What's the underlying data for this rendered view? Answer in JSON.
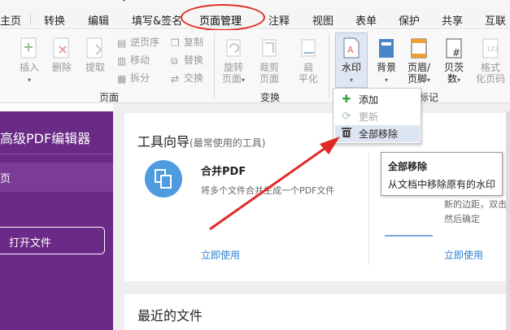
{
  "menubar": {
    "items": [
      "主页",
      "转换",
      "编辑",
      "填写&签名",
      "页面管理",
      "注释",
      "视图",
      "表单",
      "保护",
      "共享",
      "互联"
    ],
    "active": "页面管理"
  },
  "ribbon": {
    "page_group": {
      "label": "页面",
      "insert": "插入",
      "delete": "删除",
      "extract": "提取",
      "reverse": "逆页序",
      "move": "移动",
      "split": "拆分",
      "copy": "复制",
      "replace": "替换",
      "swap": "交换"
    },
    "transform_group": {
      "label": "变换",
      "rotate_line1": "旋转",
      "rotate_line2": "页面",
      "crop_line1": "裁剪",
      "crop_line2": "页面",
      "flatten_line1": "扁",
      "flatten_line2": "平化"
    },
    "mark_group": {
      "label": "标记",
      "watermark": "水印",
      "background": "背景",
      "header_footer_line1": "页眉/",
      "header_footer_line2": "页脚",
      "bates_line1": "贝茨",
      "bates_line2": "数",
      "format_line1": "格式",
      "format_line2": "化页码"
    }
  },
  "dropdown": {
    "add": "添加",
    "update": "更新",
    "remove_all": "全部移除"
  },
  "tooltip": {
    "title": "全部移除",
    "desc": "从文档中移除原有的水印"
  },
  "sidebar": {
    "title": "高级PDF编辑器",
    "home": "页",
    "open_file": "打开文件"
  },
  "main": {
    "tools_title": "工具向导",
    "tools_subtitle": "(最常使用的工具)",
    "merge_title": "合并PDF",
    "merge_desc": "将多个文件合并生成一个PDF文件",
    "use_now": "立即使用",
    "right_desc_1": "新的边距，双击",
    "right_desc_2": "然后确定",
    "recent_title": "最近的文件"
  },
  "colors": {
    "sidebar": "#6a2a86",
    "link": "#2b7fd1",
    "annotation": "#e02a26"
  }
}
